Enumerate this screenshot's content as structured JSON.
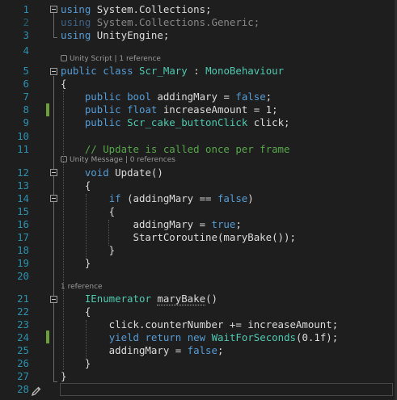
{
  "editor": {
    "lines": [
      {
        "n": "1",
        "tokens": [
          {
            "t": "using",
            "c": "kw"
          },
          {
            "t": " System.Collections;",
            "c": ""
          }
        ]
      },
      {
        "n": "2",
        "dim": true,
        "tokens": [
          {
            "t": "using",
            "c": "kw"
          },
          {
            "t": " System.Collections.Generic;",
            "c": ""
          }
        ]
      },
      {
        "n": "3",
        "tokens": [
          {
            "t": "using",
            "c": "kw"
          },
          {
            "t": " UnityEngine;",
            "c": ""
          }
        ]
      },
      {
        "n": "4",
        "tokens": []
      },
      {
        "n": "5",
        "tokens": [
          {
            "t": "public",
            "c": "kw"
          },
          {
            "t": " ",
            "c": ""
          },
          {
            "t": "class",
            "c": "kw"
          },
          {
            "t": " ",
            "c": ""
          },
          {
            "t": "Scr_Mary",
            "c": "ty"
          },
          {
            "t": " : ",
            "c": ""
          },
          {
            "t": "MonoBehaviour",
            "c": "ty"
          }
        ]
      },
      {
        "n": "6",
        "tokens": [
          {
            "t": "{",
            "c": ""
          }
        ]
      },
      {
        "n": "7",
        "tokens": [
          {
            "t": "    ",
            "c": ""
          },
          {
            "t": "public",
            "c": "kw"
          },
          {
            "t": " ",
            "c": ""
          },
          {
            "t": "bool",
            "c": "kw"
          },
          {
            "t": " addingMary = ",
            "c": ""
          },
          {
            "t": "false",
            "c": "kw"
          },
          {
            "t": ";",
            "c": ""
          }
        ]
      },
      {
        "n": "8",
        "tokens": [
          {
            "t": "    ",
            "c": ""
          },
          {
            "t": "public",
            "c": "kw"
          },
          {
            "t": " ",
            "c": ""
          },
          {
            "t": "float",
            "c": "kw"
          },
          {
            "t": " increaseAmount = 1;",
            "c": ""
          }
        ]
      },
      {
        "n": "9",
        "tokens": [
          {
            "t": "    ",
            "c": ""
          },
          {
            "t": "public",
            "c": "kw"
          },
          {
            "t": " ",
            "c": ""
          },
          {
            "t": "Scr_cake_buttonClick",
            "c": "ty"
          },
          {
            "t": " click;",
            "c": ""
          }
        ]
      },
      {
        "n": "10",
        "tokens": []
      },
      {
        "n": "11",
        "tokens": [
          {
            "t": "    ",
            "c": ""
          },
          {
            "t": "// Update is called once per frame",
            "c": "cm"
          }
        ]
      },
      {
        "n": "12",
        "tokens": [
          {
            "t": "    ",
            "c": ""
          },
          {
            "t": "void",
            "c": "kw"
          },
          {
            "t": " Update()",
            "c": ""
          }
        ]
      },
      {
        "n": "13",
        "tokens": [
          {
            "t": "    {",
            "c": ""
          }
        ]
      },
      {
        "n": "14",
        "tokens": [
          {
            "t": "        ",
            "c": ""
          },
          {
            "t": "if",
            "c": "kw"
          },
          {
            "t": " (addingMary == ",
            "c": ""
          },
          {
            "t": "false",
            "c": "kw"
          },
          {
            "t": ")",
            "c": ""
          }
        ]
      },
      {
        "n": "15",
        "tokens": [
          {
            "t": "        {",
            "c": ""
          }
        ]
      },
      {
        "n": "16",
        "tokens": [
          {
            "t": "            addingMary = ",
            "c": ""
          },
          {
            "t": "true",
            "c": "kw"
          },
          {
            "t": ";",
            "c": ""
          }
        ]
      },
      {
        "n": "17",
        "tokens": [
          {
            "t": "            StartCoroutine(maryBake());",
            "c": ""
          }
        ]
      },
      {
        "n": "18",
        "tokens": [
          {
            "t": "        }",
            "c": ""
          }
        ]
      },
      {
        "n": "19",
        "tokens": [
          {
            "t": "    }",
            "c": ""
          }
        ]
      },
      {
        "n": "20",
        "tokens": []
      },
      {
        "n": "21",
        "tokens": [
          {
            "t": "    ",
            "c": ""
          },
          {
            "t": "IEnumerator",
            "c": "ty"
          },
          {
            "t": " ",
            "c": ""
          },
          {
            "t": "maryBake",
            "c": "squig"
          },
          {
            "t": "()",
            "c": ""
          }
        ]
      },
      {
        "n": "22",
        "tokens": [
          {
            "t": "    {",
            "c": ""
          }
        ]
      },
      {
        "n": "23",
        "tokens": [
          {
            "t": "        click.counterNumber += increaseAmount;",
            "c": ""
          }
        ]
      },
      {
        "n": "24",
        "tokens": [
          {
            "t": "        ",
            "c": ""
          },
          {
            "t": "yield",
            "c": "kw"
          },
          {
            "t": " ",
            "c": ""
          },
          {
            "t": "return",
            "c": "kw"
          },
          {
            "t": " ",
            "c": ""
          },
          {
            "t": "new",
            "c": "kw"
          },
          {
            "t": " ",
            "c": ""
          },
          {
            "t": "WaitForSeconds",
            "c": "ty"
          },
          {
            "t": "(0.1f);",
            "c": ""
          }
        ]
      },
      {
        "n": "25",
        "tokens": [
          {
            "t": "        addingMary = ",
            "c": ""
          },
          {
            "t": "false",
            "c": "kw"
          },
          {
            "t": ";",
            "c": ""
          }
        ]
      },
      {
        "n": "26",
        "tokens": [
          {
            "t": "    }",
            "c": ""
          }
        ]
      },
      {
        "n": "27",
        "tokens": [
          {
            "t": "}",
            "c": ""
          }
        ]
      },
      {
        "n": "28",
        "tokens": []
      }
    ],
    "codelens": {
      "class_lens": "Unity Script | 1 reference",
      "update_lens": "Unity Message | 0 references",
      "marybake_lens": "1 reference"
    },
    "colors": {
      "background": "#1e1e1e",
      "line_number": "#2b91af",
      "keyword": "#569cd6",
      "type": "#4ec9b0",
      "comment": "#57a64a",
      "text": "#dcdcdc",
      "change_marker": "#6a9f3a"
    },
    "icons": {
      "unity_logo": "unity-logo-icon",
      "fold_toggle": "collapse-box-icon",
      "edit_pencil": "pencil-icon"
    }
  }
}
